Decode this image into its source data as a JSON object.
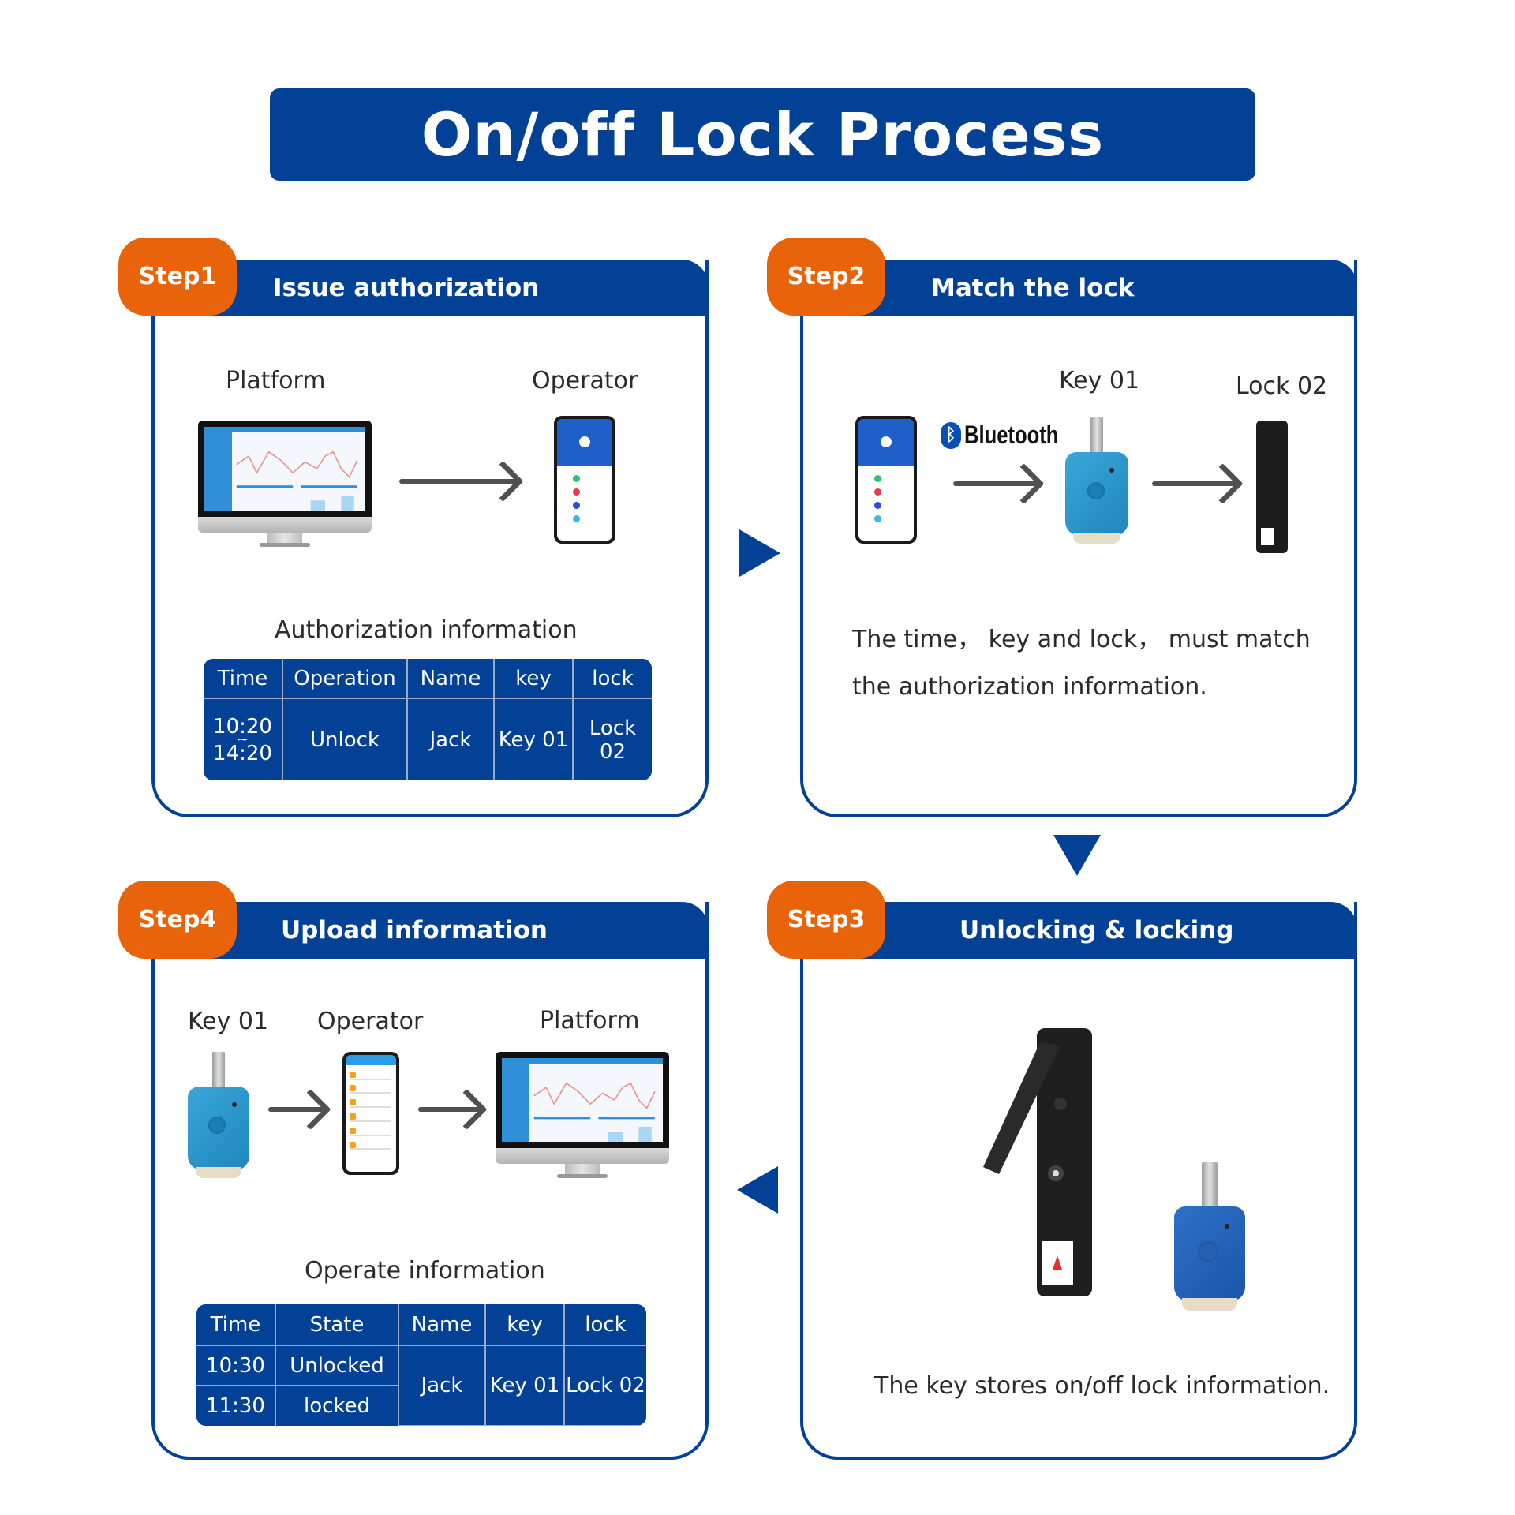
{
  "title": "On/off Lock Process",
  "colors": {
    "primary_blue": "#034197",
    "step_orange": "#e8630a",
    "text_dark": "#2a2a2a"
  },
  "steps": [
    {
      "tab": "Step1",
      "title": "Issue authorization",
      "labels": {
        "from": "Platform",
        "to": "Operator"
      },
      "table_caption": "Authorization information",
      "table": {
        "headers": [
          "Time",
          "Operation",
          "Name",
          "key",
          "lock"
        ],
        "row": {
          "time_start": "10:20",
          "time_sep": "~",
          "time_end": "14:20",
          "operation": "Unlock",
          "name": "Jack",
          "key": "Key 01",
          "lock": "Lock 02"
        }
      }
    },
    {
      "tab": "Step2",
      "title": "Match the lock",
      "labels": {
        "key": "Key 01",
        "lock": "Lock 02",
        "bluetooth": "Bluetooth",
        "bluetooth_icon": "bluetooth-icon"
      },
      "description_line1": "The time， key and lock， must match",
      "description_line2": "the authorization information."
    },
    {
      "tab": "Step3",
      "title": "Unlocking &  locking",
      "description": "The key stores on/off lock information."
    },
    {
      "tab": "Step4",
      "title": "Upload information",
      "labels": {
        "key": "Key 01",
        "operator": "Operator",
        "platform": "Platform"
      },
      "table_caption": "Operate information",
      "table": {
        "headers": [
          "Time",
          "State",
          "Name",
          "key",
          "lock"
        ],
        "rows": [
          {
            "time": "10:30",
            "state": "Unlocked"
          },
          {
            "time": "11:30",
            "state": "locked"
          }
        ],
        "shared": {
          "name": "Jack",
          "key": "Key 01",
          "lock": "Lock 02"
        }
      }
    }
  ],
  "flow_arrows": [
    "right",
    "down",
    "left"
  ]
}
